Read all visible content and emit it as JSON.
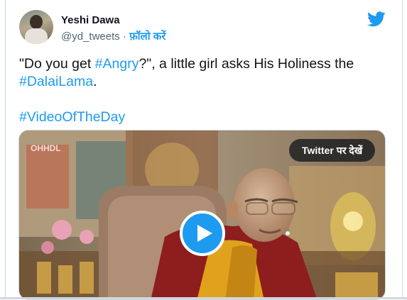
{
  "author": {
    "name": "Yeshi Dawa",
    "handle": "@yd_tweets",
    "separator": " · ",
    "follow_label": "फ़ॉलो करें"
  },
  "icons": {
    "brand": "twitter-bird-icon",
    "play": "play-icon",
    "avatar": "avatar"
  },
  "colors": {
    "link": "#1d9bf0",
    "text": "#0f1419",
    "muted": "#536471",
    "border": "#cfd9de"
  },
  "tweet": {
    "line1_prefix": "\"Do you get ",
    "line1_tag": "#Angry",
    "line1_suffix": "?\", a little girl asks His Holiness the",
    "line2_tag": "#DalaiLama",
    "line2_suffix": ".",
    "hashtag": "#VideoOfTheDay"
  },
  "media": {
    "watermark": "OHHDL",
    "watch_label": "Twitter पर देखें"
  }
}
